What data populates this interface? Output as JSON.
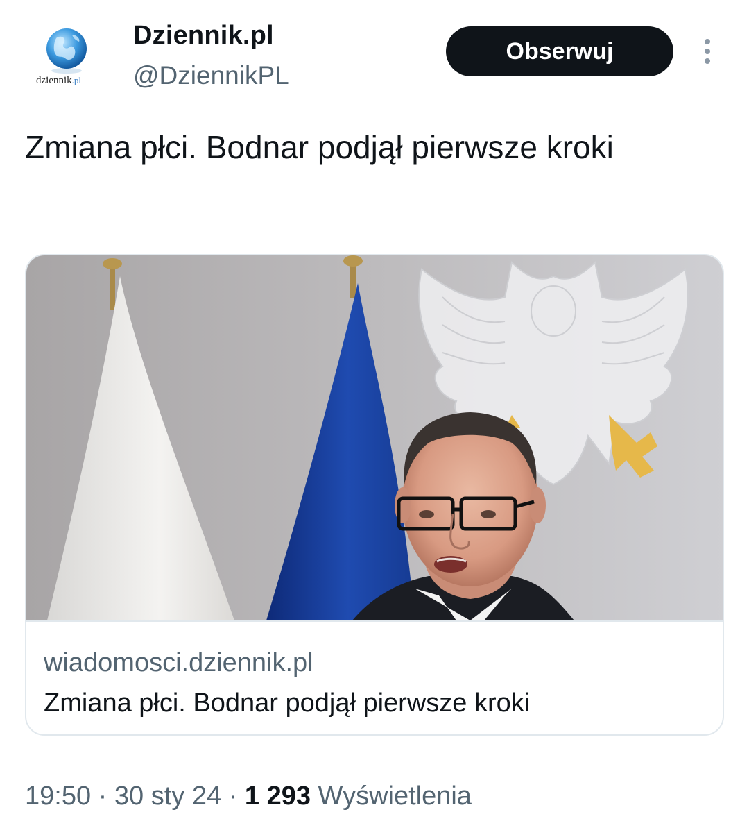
{
  "account": {
    "name": "Dziennik.pl",
    "handle": "@DziennikPL",
    "avatar_text": "dziennik",
    "avatar_suffix": ".pl",
    "follow_label": "Obserwuj"
  },
  "tweet": {
    "text": "Zmiana płci. Bodnar podjął pierwsze kroki"
  },
  "card": {
    "domain": "wiadomosci.dziennik.pl",
    "title": "Zmiana płci. Bodnar podjął pierwsze kroki"
  },
  "meta": {
    "time": "19:50",
    "separator": "·",
    "date": "30 sty 24",
    "views_count": "1 293",
    "views_label": "Wyświetlenia"
  },
  "colors": {
    "text_primary": "#0f1419",
    "text_secondary": "#536471",
    "button_bg": "#0f1419",
    "border": "#e1e8ed"
  },
  "icons": {
    "more": "more-vertical-icon",
    "avatar_globe": "globe-icon"
  }
}
